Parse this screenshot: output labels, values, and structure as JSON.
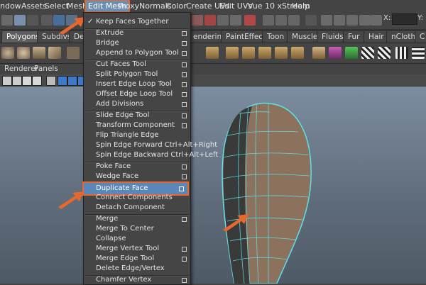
{
  "menubar": {
    "items": [
      {
        "label": "ndow"
      },
      {
        "label": "Assets"
      },
      {
        "label": "Select"
      },
      {
        "label": "Mesh"
      },
      {
        "label": "Edit Mesh"
      },
      {
        "label": "Proxy"
      },
      {
        "label": "Normals"
      },
      {
        "label": "Color"
      },
      {
        "label": "Create UVs"
      },
      {
        "label": "Edit UVs"
      },
      {
        "label": "Vue 10 xStream"
      },
      {
        "label": "Help"
      }
    ]
  },
  "coords": {
    "x_label": "X:",
    "y_label": "Y:"
  },
  "shelf_tabs": [
    {
      "label": "Polygons"
    },
    {
      "label": "Subdivs"
    },
    {
      "label": "Defo"
    },
    {
      "label": "endering"
    },
    {
      "label": "PaintEffects"
    },
    {
      "label": "Toon"
    },
    {
      "label": "Muscle"
    },
    {
      "label": "Fluids"
    },
    {
      "label": "Fur"
    },
    {
      "label": "Hair"
    },
    {
      "label": "nCloth"
    },
    {
      "label": "C"
    }
  ],
  "panel_menu": {
    "items": [
      {
        "label": "Renderer"
      },
      {
        "label": "Panels"
      }
    ]
  },
  "dropdown": {
    "items": [
      {
        "label": "Keep Faces Together",
        "checked": true,
        "option": false
      },
      {
        "label": "Extrude",
        "option": true
      },
      {
        "label": "Bridge",
        "option": true
      },
      {
        "label": "Append to Polygon Tool",
        "option": true
      },
      {
        "label": "Cut Faces Tool",
        "option": true
      },
      {
        "label": "Split Polygon Tool",
        "option": true
      },
      {
        "label": "Insert Edge Loop Tool",
        "option": true
      },
      {
        "label": "Offset Edge Loop Tool",
        "option": true
      },
      {
        "label": "Add Divisions",
        "option": true
      },
      {
        "label": "Slide Edge Tool",
        "option": true
      },
      {
        "label": "Transform Component",
        "option": true
      },
      {
        "label": "Flip Triangle Edge",
        "option": false
      },
      {
        "label": "Spin Edge Forward  Ctrl+Alt+Right",
        "option": false
      },
      {
        "label": "Spin Edge Backward  Ctrl+Alt+Left",
        "option": false
      },
      {
        "label": "Poke Face",
        "option": true
      },
      {
        "label": "Wedge Face",
        "option": true
      },
      {
        "label": "Duplicate Face",
        "option": true,
        "highlighted": true
      },
      {
        "label": "Connect Components",
        "option": false
      },
      {
        "label": "Detach Component",
        "option": false
      },
      {
        "label": "Merge",
        "option": true
      },
      {
        "label": "Merge To Center",
        "option": false
      },
      {
        "label": "Collapse",
        "option": false
      },
      {
        "label": "Merge Vertex Tool",
        "option": true
      },
      {
        "label": "Merge Edge Tool",
        "option": true
      },
      {
        "label": "Delete Edge/Vertex",
        "option": false
      },
      {
        "label": "Chamfer Vertex",
        "option": true
      }
    ]
  },
  "colors": {
    "accent": "#e8672d",
    "highlight": "#5b86b8",
    "mesh_face": "#8c725d",
    "mesh_wire": "#5de1e6"
  }
}
